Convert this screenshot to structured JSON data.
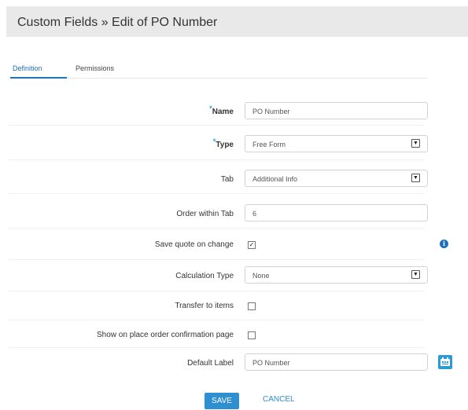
{
  "header": {
    "title": "Custom Fields » Edit of PO Number"
  },
  "tabs": [
    {
      "label": "Definition",
      "active": true
    },
    {
      "label": "Permissions",
      "active": false
    }
  ],
  "form": {
    "name": {
      "label": "Name",
      "required_mark": "*",
      "value": "PO Number"
    },
    "type": {
      "label": "Type",
      "required_mark": "*",
      "value": "Free Form"
    },
    "tab": {
      "label": "Tab",
      "value": "Additional Info"
    },
    "order_within_tab": {
      "label": "Order within Tab",
      "value": "6"
    },
    "save_quote_on_change": {
      "label": "Save quote on change",
      "checked": true,
      "info_icon": "info-icon"
    },
    "calculation_type": {
      "label": "Calculation Type",
      "value": "None"
    },
    "transfer_to_items": {
      "label": "Transfer to items",
      "checked": false
    },
    "show_on_place_order": {
      "label": "Show on place order confirmation page",
      "checked": false
    },
    "default_label": {
      "label": "Default Label",
      "value": "PO Number",
      "button_icon": "translate-icon"
    }
  },
  "actions": {
    "save_label": "SAVE",
    "cancel_label": "CANCEL"
  },
  "colors": {
    "accent": "#2b9bd8",
    "primary_button": "#2f8fd1",
    "header_bg": "#e9e9e9"
  }
}
